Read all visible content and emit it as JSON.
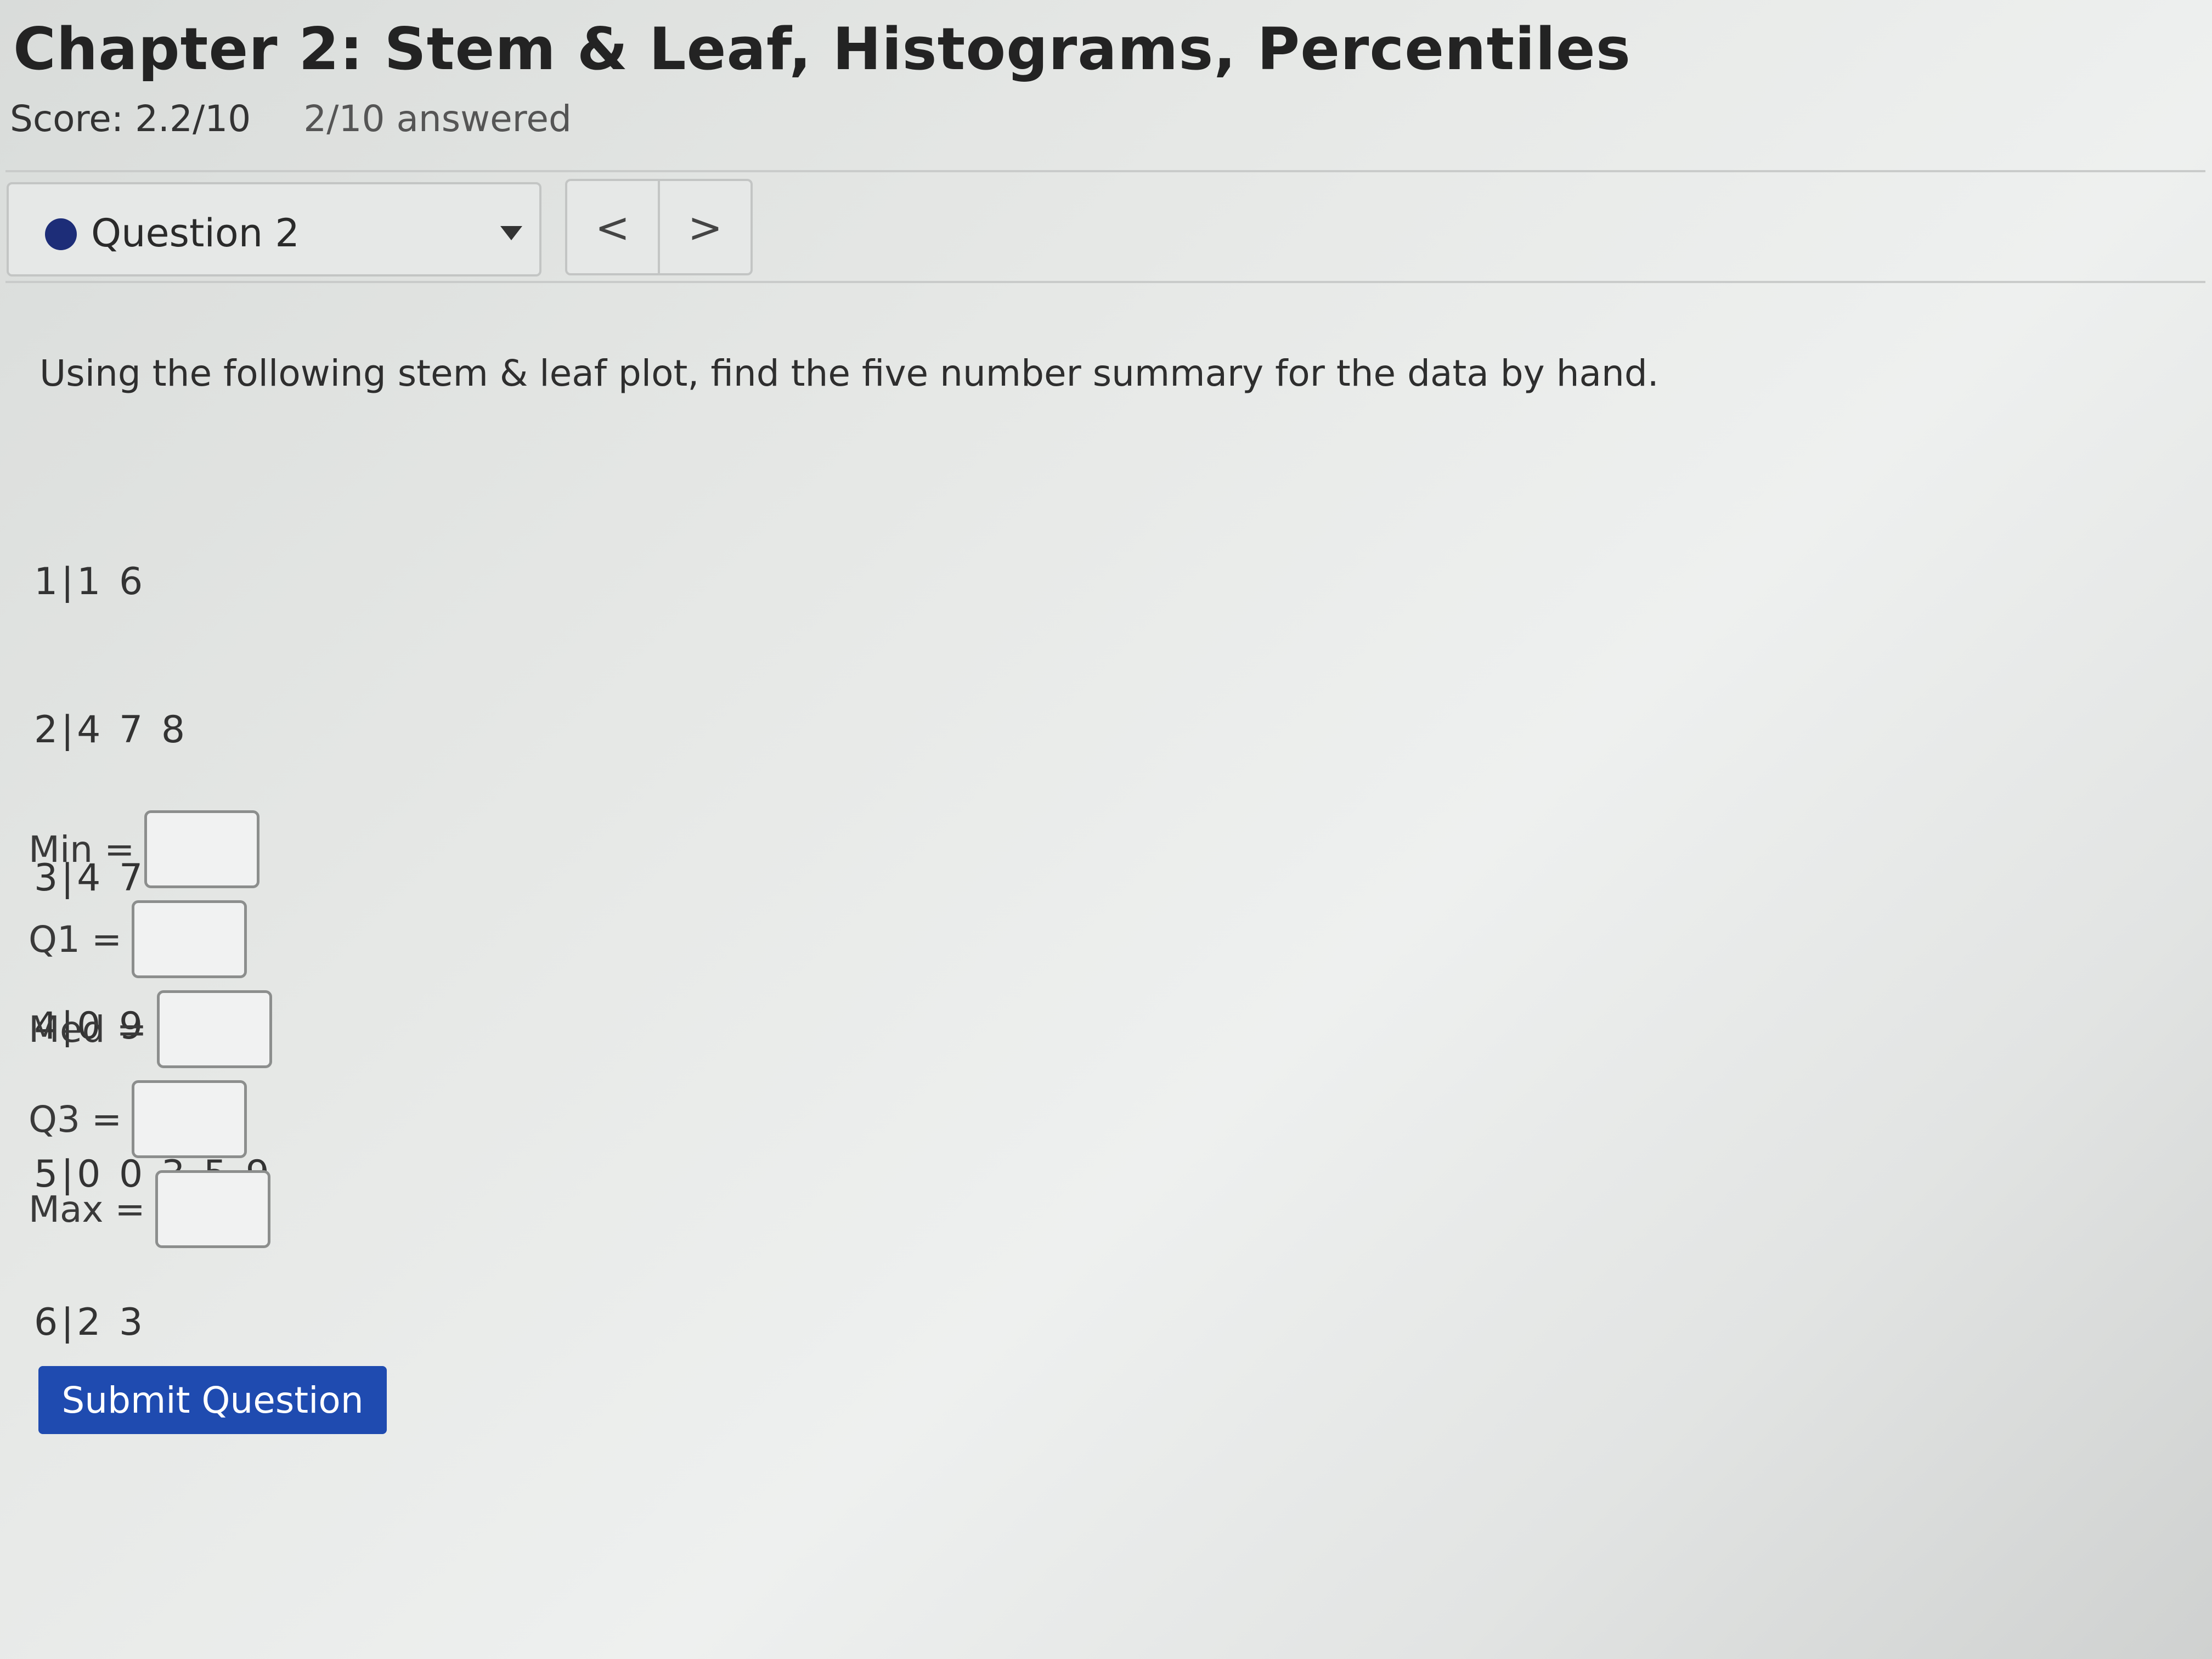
{
  "header": {
    "title": "Chapter 2: Stem & Leaf, Histograms, Percentiles",
    "score": "Score: 2.2/10",
    "answered": "2/10 answered"
  },
  "question_nav": {
    "selected": "Question 2",
    "status_color": "#1d2d78",
    "prev_symbol": "<",
    "next_symbol": ">"
  },
  "question": {
    "prompt": "Using the following stem & leaf plot, find the five number summary for the data by hand.",
    "stem_leaf_rows": [
      "1|1 6",
      "2|4 7 8",
      "3|4 7",
      "4|0 9 9 9",
      "5|0 0 3 5 9",
      "6|2 3"
    ]
  },
  "answers": {
    "min_label": "Min =",
    "q1_label": "Q1 =",
    "med_label": "Med =",
    "q3_label": "Q3 =",
    "max_label": "Max =",
    "min_value": "",
    "q1_value": "",
    "med_value": "",
    "q3_value": "",
    "max_value": ""
  },
  "submit": {
    "label": "Submit Question",
    "color": "#1f4bb0"
  }
}
